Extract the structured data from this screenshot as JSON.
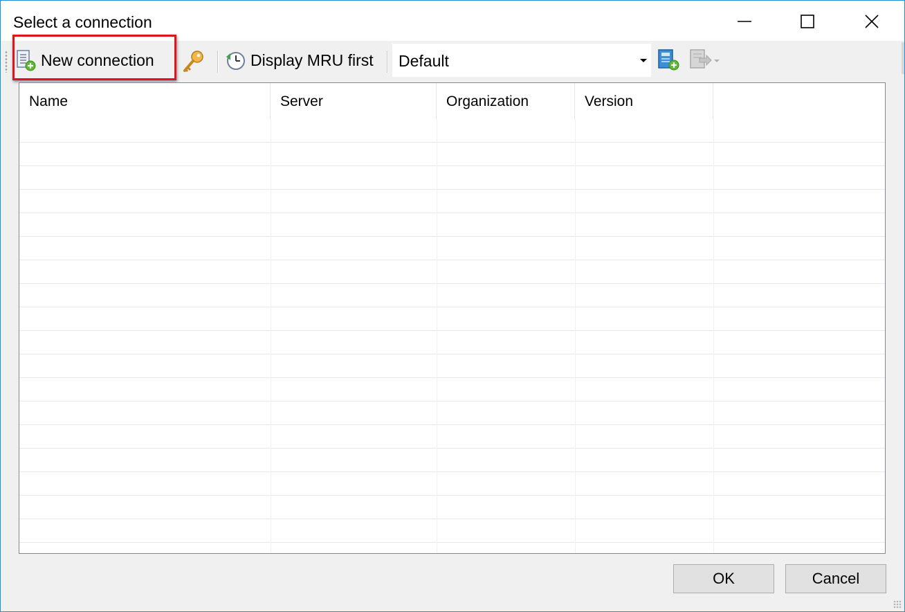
{
  "window": {
    "title": "Select a connection",
    "controls": {
      "minimize": "minimize-icon",
      "maximize": "maximize-icon",
      "close": "close-icon"
    },
    "accent_color": "#1c8fd6"
  },
  "toolbar": {
    "new_connection_label": "New connection",
    "display_mru_label": "Display MRU first",
    "profile_select": {
      "value": "Default"
    },
    "icons": {
      "new_connection": "new-connection-icon",
      "password": "key-icon",
      "mru": "history-clock-icon",
      "add_profile": "add-profile-icon",
      "export": "export-icon"
    },
    "highlight_color": "#e0141e"
  },
  "grid": {
    "columns": [
      "Name",
      "Server",
      "Organization",
      "Version"
    ],
    "rows": []
  },
  "buttons": {
    "ok_label": "OK",
    "cancel_label": "Cancel"
  }
}
